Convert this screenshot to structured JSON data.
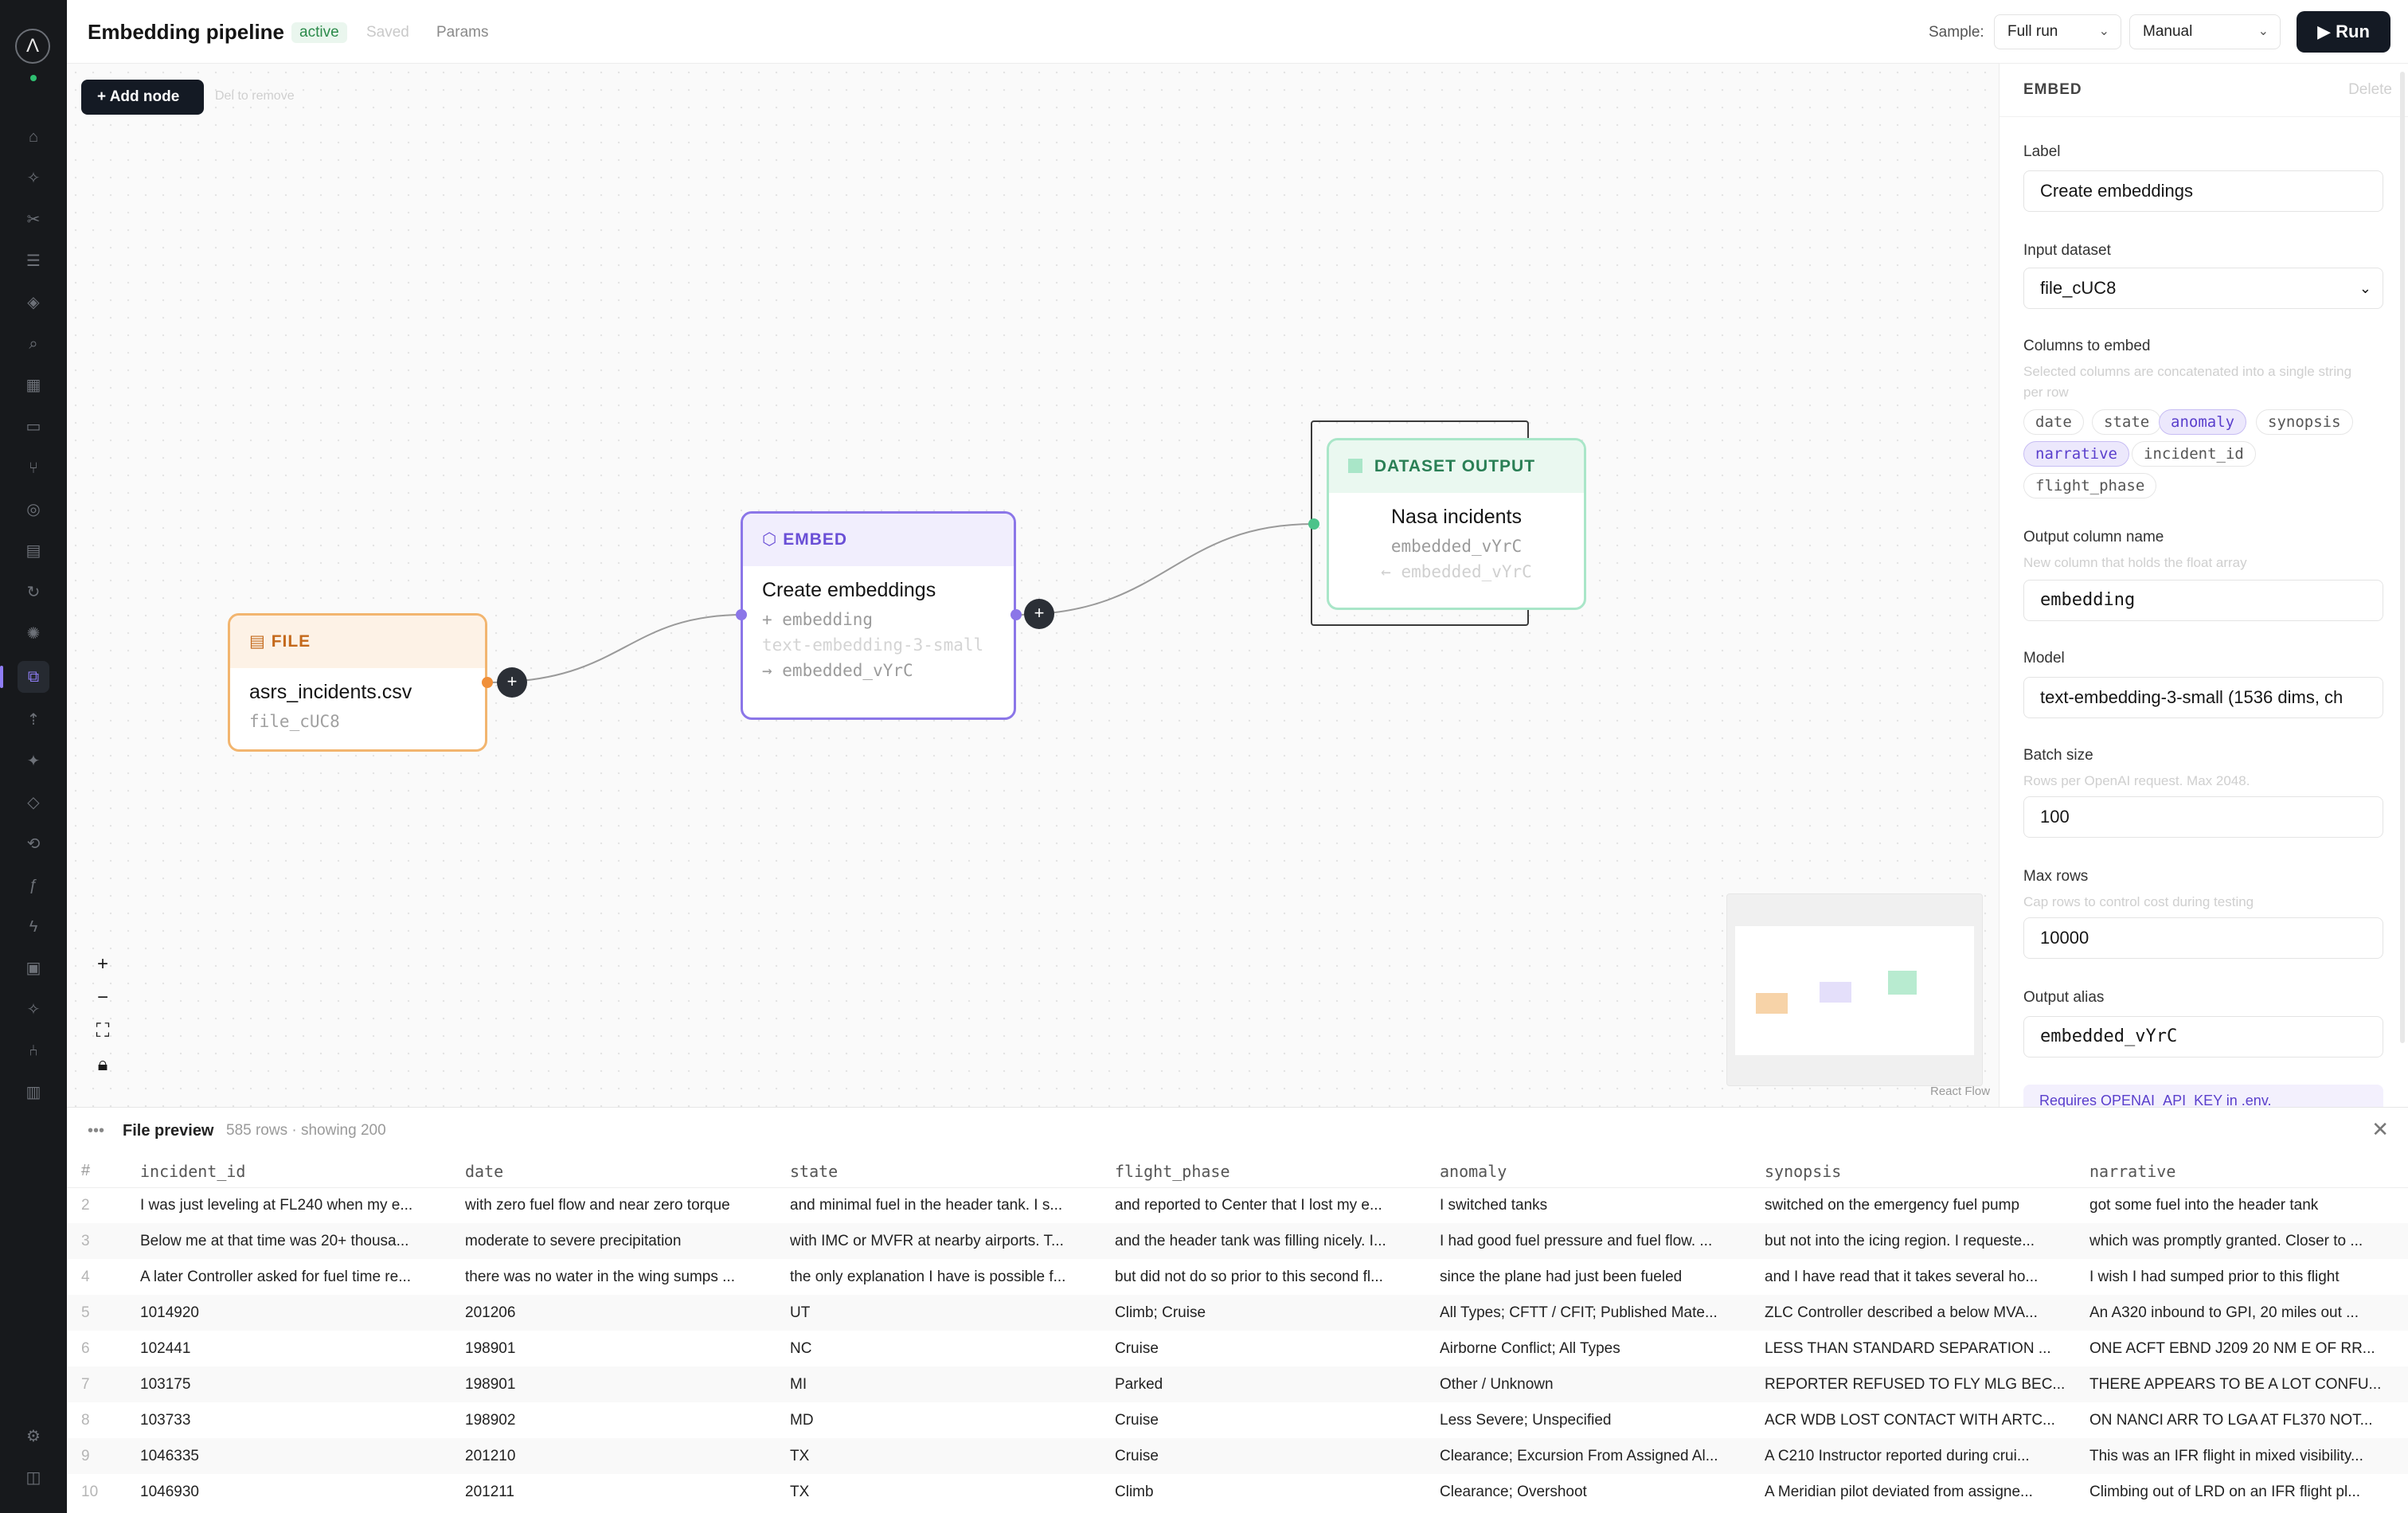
{
  "header": {
    "title": "Embedding pipeline",
    "status": "active",
    "saved": "Saved",
    "params": "Params",
    "sample_label": "Sample:",
    "sample_value": "Full run",
    "mode_value": "Manual",
    "run_label": "Run"
  },
  "canvas": {
    "add_node_label": "Add node",
    "delete_hint": "Del to remove",
    "attribution": "React Flow",
    "nodes": {
      "file": {
        "type": "FILE",
        "title": "asrs_incidents.csv",
        "sub": "file_cUC8"
      },
      "embed": {
        "type": "EMBED",
        "title": "Create embeddings",
        "out_col": "+ embedding",
        "model": "text-embedding-3-small",
        "alias": "→ embedded_vYrC"
      },
      "output": {
        "type": "DATASET OUTPUT",
        "title": "Nasa incidents",
        "alias": "embedded_vYrC",
        "input": "← embedded_vYrC"
      }
    }
  },
  "panel": {
    "type": "EMBED",
    "delete": "Delete",
    "label_label": "Label",
    "label_value": "Create embeddings",
    "input_label": "Input dataset",
    "input_value": "file_cUC8",
    "columns_label": "Columns to embed",
    "columns_help": "Selected columns are concatenated into a single string per row",
    "columns": [
      {
        "name": "date",
        "selected": false
      },
      {
        "name": "state",
        "selected": false
      },
      {
        "name": "anomaly",
        "selected": true
      },
      {
        "name": "synopsis",
        "selected": false
      },
      {
        "name": "narrative",
        "selected": true
      },
      {
        "name": "incident_id",
        "selected": false
      },
      {
        "name": "flight_phase",
        "selected": false
      }
    ],
    "output_col_label": "Output column name",
    "output_col_help": "New column that holds the float array",
    "output_col_value": "embedding",
    "model_label": "Model",
    "model_value": "text-embedding-3-small (1536 dims, ch",
    "batch_label": "Batch size",
    "batch_help": "Rows per OpenAI request. Max 2048.",
    "batch_value": "100",
    "maxrows_label": "Max rows",
    "maxrows_help": "Cap rows to control cost during testing",
    "maxrows_value": "10000",
    "alias_label": "Output alias",
    "alias_value": "embedded_vYrC",
    "api_note": "Requires OPENAI_API_KEY in .env."
  },
  "preview": {
    "title": "File preview",
    "meta": "585 rows · showing 200",
    "columns": [
      "#",
      "incident_id",
      "date",
      "state",
      "flight_phase",
      "anomaly",
      "synopsis",
      "narrative"
    ],
    "rows": [
      [
        "2",
        "I was just leveling at FL240 when my e...",
        "with zero fuel flow and near zero torque",
        "and minimal fuel in the header tank. I s...",
        "and reported to Center that I lost my e...",
        "I switched tanks",
        "switched on the emergency fuel pump",
        "got some fuel into the header tank"
      ],
      [
        "3",
        "Below me at that time was 20+ thousa...",
        "moderate to severe precipitation",
        "with IMC or MVFR at nearby airports. T...",
        "and the header tank was filling nicely. I...",
        "I had good fuel pressure and fuel flow. ...",
        "but not into the icing region. I requeste...",
        "which was promptly granted. Closer to ..."
      ],
      [
        "4",
        "A later Controller asked for fuel time re...",
        "there was no water in the wing sumps ...",
        "the only explanation I have is possible f...",
        "but did not do so prior to this second fl...",
        "since the plane had just been fueled",
        "and I have read that it takes several ho...",
        "I wish I had sumped prior to this flight"
      ],
      [
        "5",
        "1014920",
        "201206",
        "UT",
        "Climb; Cruise",
        "All Types; CFTT / CFIT; Published Mate...",
        "ZLC Controller described a below MVA...",
        "An A320 inbound to GPI, 20 miles out ..."
      ],
      [
        "6",
        "102441",
        "198901",
        "NC",
        "Cruise",
        "Airborne Conflict; All Types",
        "LESS THAN STANDARD SEPARATION ...",
        "ONE ACFT EBND J209 20 NM E OF RR..."
      ],
      [
        "7",
        "103175",
        "198901",
        "MI",
        "Parked",
        "Other / Unknown",
        "REPORTER REFUSED TO FLY MLG BEC...",
        "THERE APPEARS TO BE A LOT CONFU..."
      ],
      [
        "8",
        "103733",
        "198902",
        "MD",
        "Cruise",
        "Less Severe; Unspecified",
        "ACR WDB LOST CONTACT WITH ARTC...",
        "ON NANCI ARR TO LGA AT FL370 NOT..."
      ],
      [
        "9",
        "1046335",
        "201210",
        "TX",
        "Cruise",
        "Clearance; Excursion From Assigned Al...",
        "A C210 Instructor reported during crui...",
        "This was an IFR flight in mixed visibility..."
      ],
      [
        "10",
        "1046930",
        "201211",
        "TX",
        "Climb",
        "Clearance; Overshoot",
        "A Meridian pilot deviated from assigne...",
        "Climbing out of LRD on an IFR flight pl..."
      ]
    ]
  },
  "colors": {
    "file": "#f2b56f",
    "embed": "#8b76e8",
    "output": "#a9e6c8",
    "primary": "#141a24"
  }
}
